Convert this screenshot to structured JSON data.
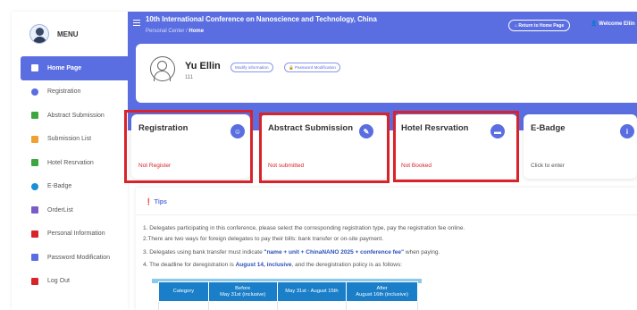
{
  "app": {
    "title": "10th International Conference on Nanoscience and Technology, China",
    "breadcrumb_root": "Personal Center",
    "breadcrumb_sep": "/",
    "breadcrumb_current": "Home",
    "return_button": "⌂ Return to Home Page",
    "welcome": "👤 Welcome Ellin"
  },
  "sidebar": {
    "menu_label": "MENU",
    "items": [
      {
        "label": "Home Page",
        "icon": "home-icon",
        "active": true,
        "color": "#ffffff"
      },
      {
        "label": "Registration",
        "icon": "user-circle-icon",
        "color": "#5b6ee1"
      },
      {
        "label": "Abstract Submission",
        "icon": "edit-icon",
        "color": "#3fa63f"
      },
      {
        "label": "Submission List",
        "icon": "list-icon",
        "color": "#f0a030"
      },
      {
        "label": "Hotel Resrvation",
        "icon": "bed-icon",
        "color": "#3fa63f"
      },
      {
        "label": "E-Badge",
        "icon": "info-icon",
        "color": "#1a8fd6"
      },
      {
        "label": "OrderList",
        "icon": "order-icon",
        "color": "#7a5cc8"
      },
      {
        "label": "Personal Information",
        "icon": "id-card-icon",
        "color": "#d8232a"
      },
      {
        "label": "Password Modification",
        "icon": "lock-icon",
        "color": "#5b6ee1"
      },
      {
        "label": "Log Out",
        "icon": "logout-icon",
        "color": "#d8232a"
      }
    ]
  },
  "profile": {
    "name": "Yu Ellin",
    "id": "111",
    "modify_info": "Modify information",
    "password_mod": "🔒 Password Modification"
  },
  "cards": [
    {
      "title": "Registration",
      "status": "Not Register",
      "status_type": "red",
      "icon": "user-circle-icon",
      "glyph": "☺"
    },
    {
      "title": "Abstract Submission",
      "status": "Not submitted",
      "status_type": "red",
      "icon": "edit-icon",
      "glyph": "✎"
    },
    {
      "title": "Hotel Resrvation",
      "status": "Not Booked",
      "status_type": "red",
      "icon": "bed-icon",
      "glyph": "▬"
    },
    {
      "title": "E-Badge",
      "status": "Click to enter",
      "status_type": "gray",
      "icon": "info-icon",
      "glyph": "i"
    }
  ],
  "tips": {
    "title": "Tips",
    "line1": "1. Delegates participating in this conference, please select the corresponding registration type, pay the registration fee online.",
    "line2": "2.There are two ways for foreign delegates to pay their bills: bank transfer or on-site payment.",
    "line3_pre": "3. Delegates using bank transfer must indicate ",
    "line3_hl": "\"name + unit + ChinaNANO 2025 + conference fee\"",
    "line3_post": " when paying.",
    "line4_pre": "4. The deadline for deregistration is ",
    "line4_hl": "August 14, inclusive",
    "line4_post": ", and the deregistration policy is as follows:",
    "table_headers": [
      "Category",
      "Before May 31st (inclusive)",
      "May 31st - August 15th",
      "After August 16th (inclusive)"
    ],
    "table_headers_sub": [
      "",
      "May 31st (inclusive)",
      "",
      "August 16th (inclusive)"
    ]
  }
}
